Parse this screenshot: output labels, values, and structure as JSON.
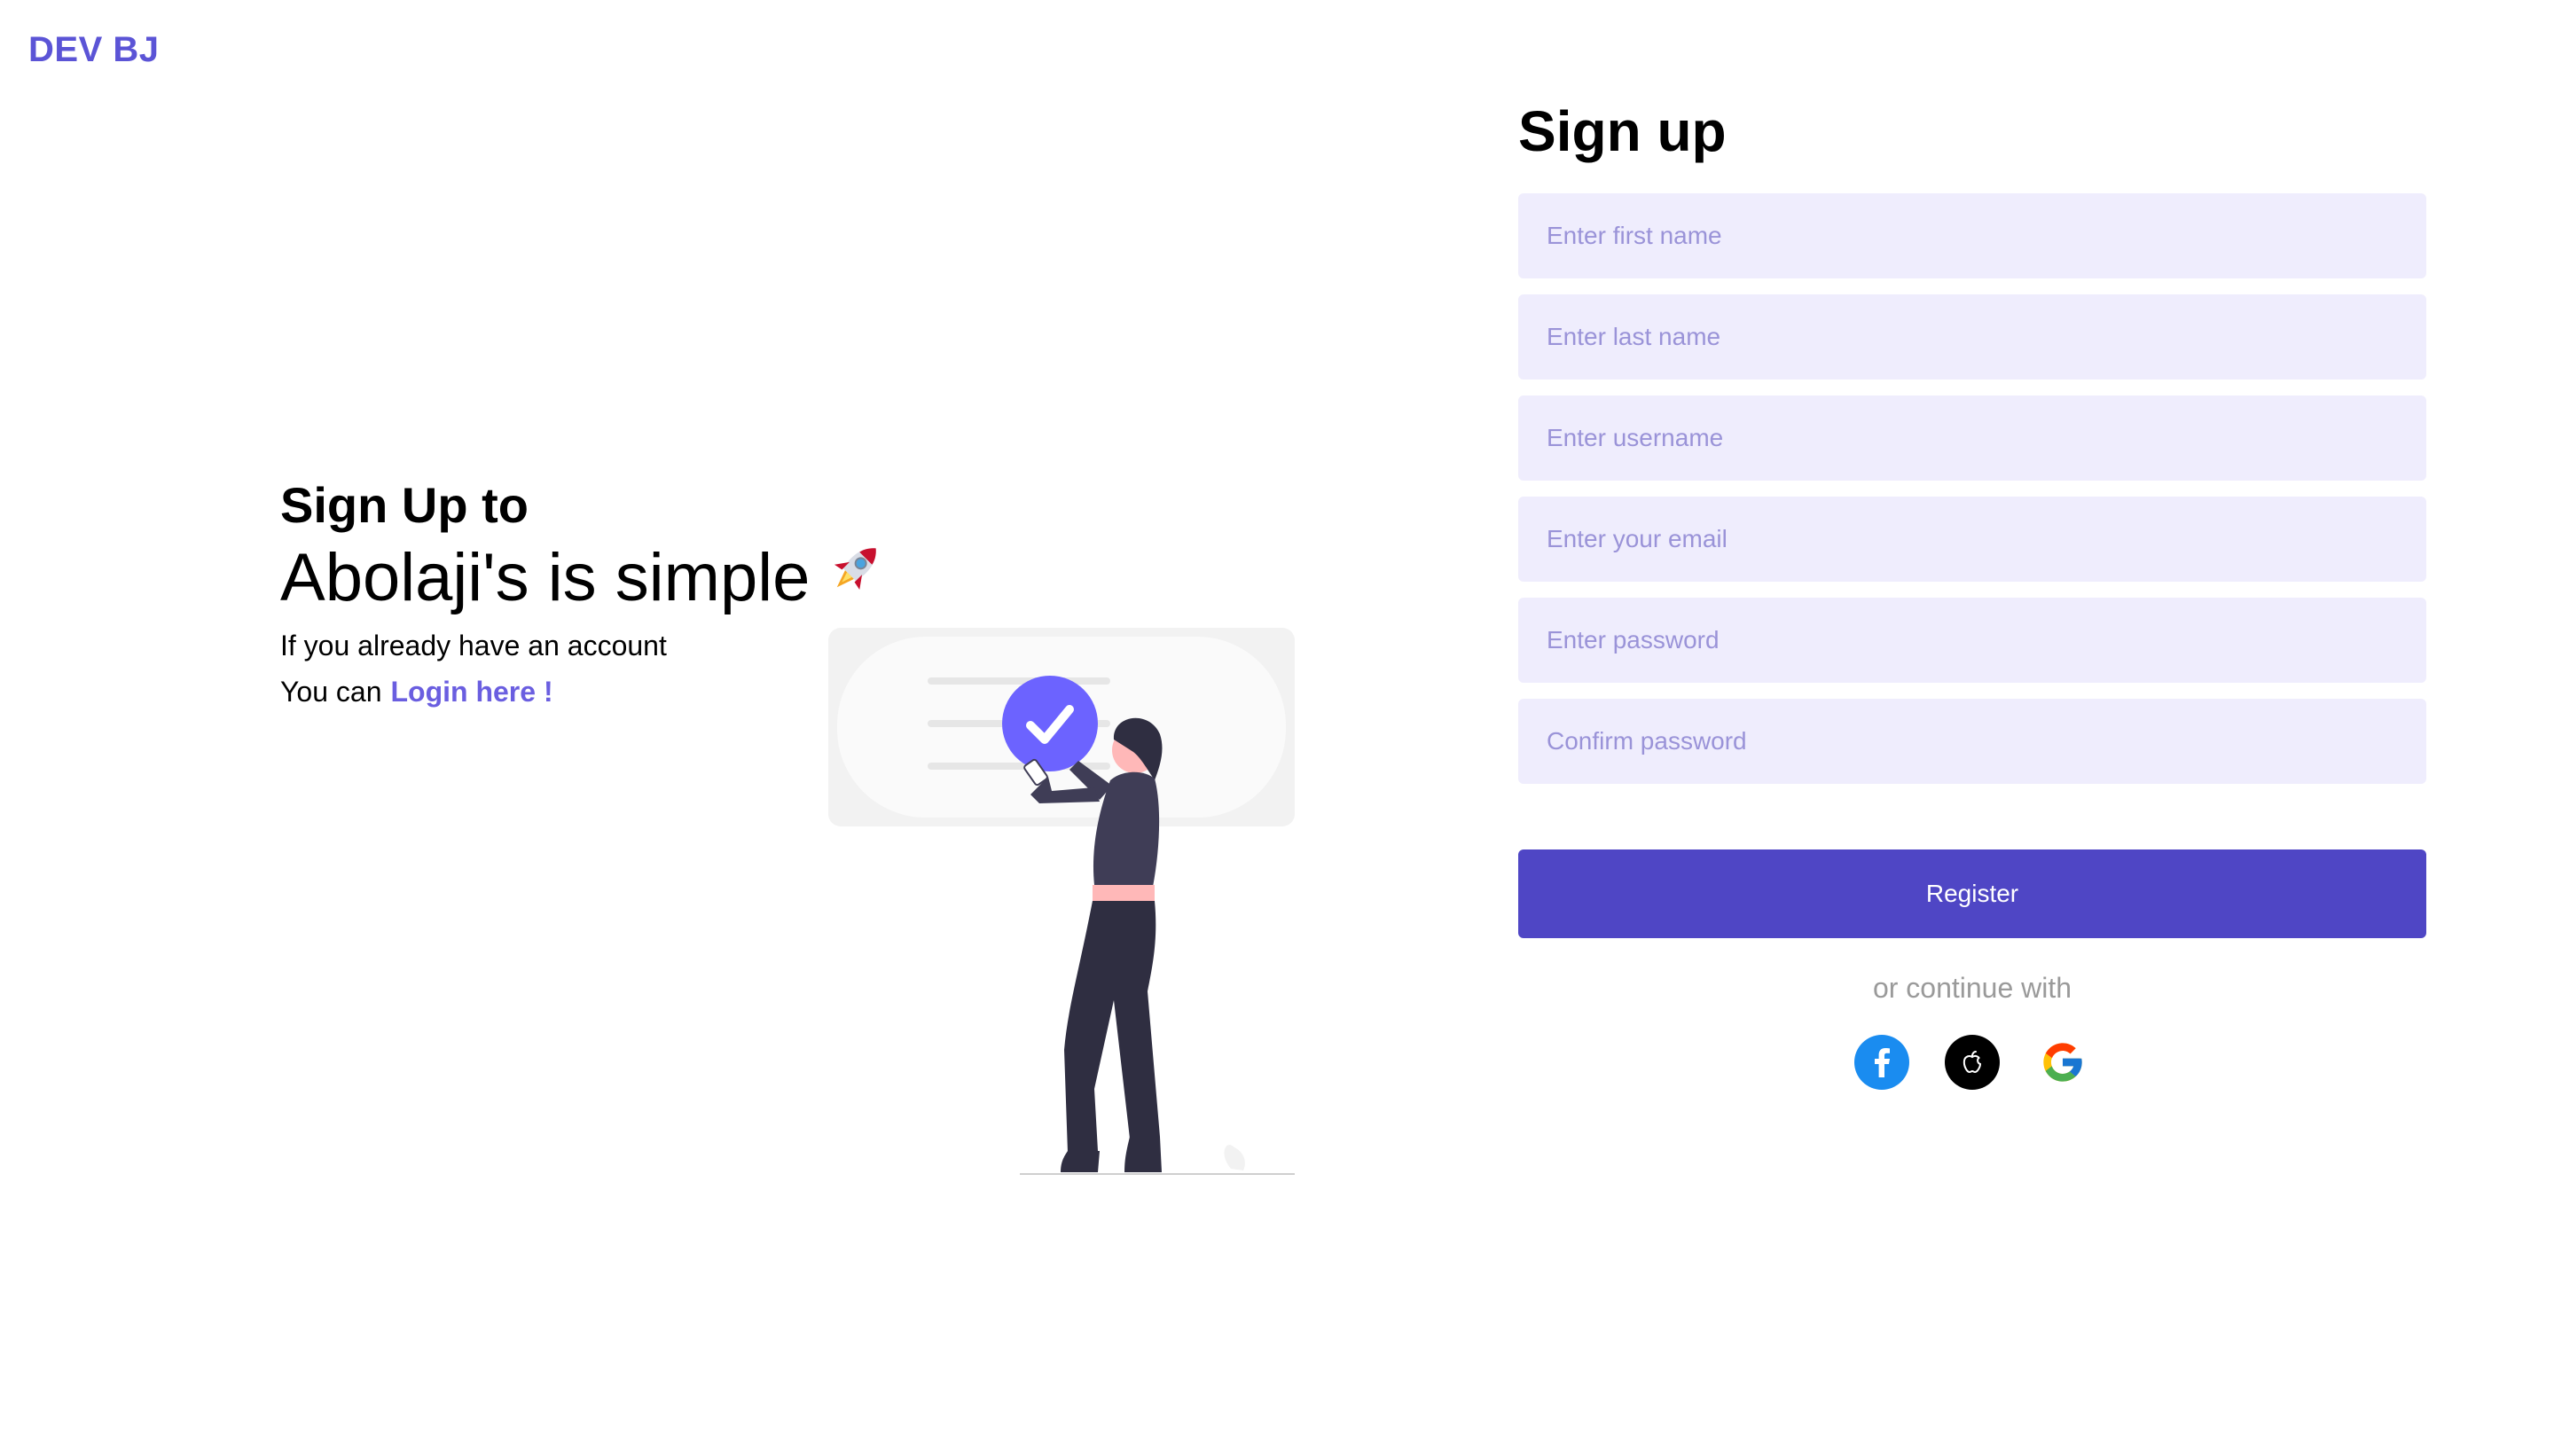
{
  "brand": {
    "logo": "DEV BJ",
    "accent": "#5b54d6",
    "button_color": "#4f46c5",
    "field_bg": "#efedfd"
  },
  "intro": {
    "heading_line1": "Sign Up to",
    "heading_line2": "Abolaji's is simple",
    "rocket_icon": "rocket-icon",
    "text_line1": "If you already have an account",
    "text_line2_prefix": "You can",
    "login_link": "Login here !"
  },
  "form": {
    "title": "Sign up",
    "fields": {
      "first_name": "Enter first name",
      "last_name": "Enter last name",
      "username": "Enter username",
      "email": "Enter your email",
      "password": "Enter password",
      "confirm_password": "Confirm password"
    },
    "register_label": "Register",
    "continue_text": "or continue with",
    "socials": [
      "facebook-icon",
      "apple-icon",
      "google-icon"
    ]
  }
}
